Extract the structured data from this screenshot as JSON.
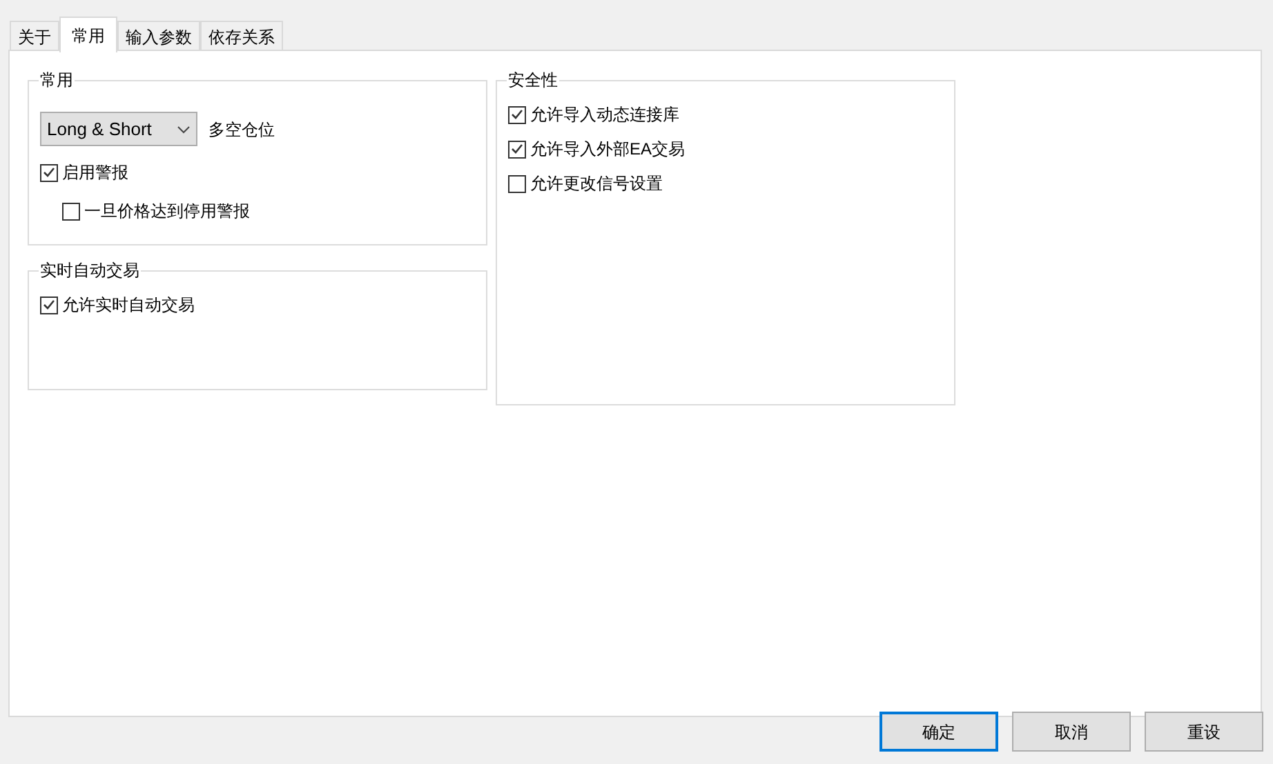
{
  "tabs": [
    {
      "label": "关于",
      "selected": false
    },
    {
      "label": "常用",
      "selected": true
    },
    {
      "label": "输入参数",
      "selected": false
    },
    {
      "label": "依存关系",
      "selected": false
    }
  ],
  "columns": [
    [
      {
        "title": "常用",
        "items": [
          {
            "kind": "dropdown",
            "value": "Long & Short",
            "caption": "多空仓位"
          },
          {
            "kind": "checkbox",
            "label": "启用警报",
            "checked": true,
            "children": [
              {
                "kind": "checkbox",
                "label": "一旦价格达到停用警报",
                "checked": false
              }
            ]
          }
        ]
      },
      {
        "title": "实时自动交易",
        "items": [
          {
            "kind": "checkbox",
            "label": "允许实时自动交易",
            "checked": true
          }
        ]
      }
    ],
    [
      {
        "title": "安全性",
        "items": [
          {
            "kind": "checkbox",
            "label": "允许导入动态连接库",
            "checked": true
          },
          {
            "kind": "checkbox",
            "label": "允许导入外部EA交易",
            "checked": true
          },
          {
            "kind": "checkbox",
            "label": "允许更改信号设置",
            "checked": false
          }
        ]
      }
    ]
  ],
  "buttons": [
    {
      "label": "确定",
      "default": true
    },
    {
      "label": "取消",
      "default": false
    },
    {
      "label": "重设",
      "default": false
    }
  ]
}
